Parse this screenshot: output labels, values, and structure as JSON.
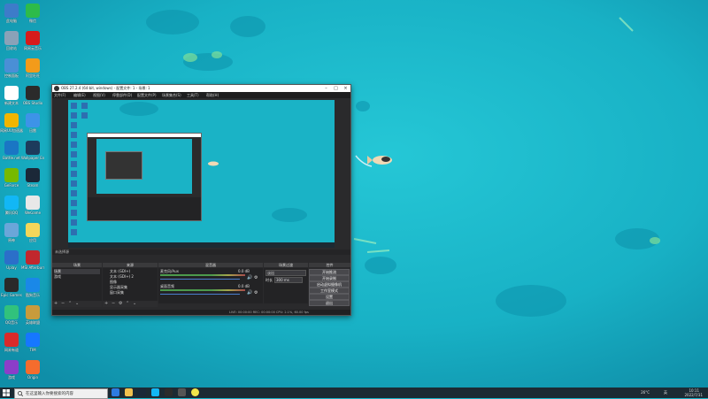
{
  "desktop": {
    "icons": [
      {
        "label": "此电脑",
        "color": "#3d7cc9"
      },
      {
        "label": "微信",
        "color": "#2dbb4a"
      },
      {
        "label": "回收站",
        "color": "#8aa2b8"
      },
      {
        "label": "网易云音乐",
        "color": "#d71b1b"
      },
      {
        "label": "控制面板",
        "color": "#4a8fd6"
      },
      {
        "label": "阿里旺旺",
        "color": "#f39b1a"
      },
      {
        "label": "新建文本",
        "color": "#ffffff"
      },
      {
        "label": "OBS Studio",
        "color": "#2b2b2b"
      },
      {
        "label": "网易UU加速器",
        "color": "#f0b500"
      },
      {
        "label": "迅雷",
        "color": "#3d93e8"
      },
      {
        "label": "Battle.net",
        "color": "#1a76c4"
      },
      {
        "label": "Wallpaper Engine",
        "color": "#1d3b5c"
      },
      {
        "label": "GeForce",
        "color": "#76b900"
      },
      {
        "label": "Steam",
        "color": "#1b2838"
      },
      {
        "label": "腾讯QQ",
        "color": "#12b7f5"
      },
      {
        "label": "WeGame",
        "color": "#e8e8e8"
      },
      {
        "label": "原神",
        "color": "#6aa6d9"
      },
      {
        "label": "应用",
        "color": "#f3d65a"
      },
      {
        "label": "Uplay",
        "color": "#2b6fc9"
      },
      {
        "label": "MSI Afterburner",
        "color": "#c1272d"
      },
      {
        "label": "Epic Games",
        "color": "#2a2a2a"
      },
      {
        "label": "酷狗音乐",
        "color": "#1a88e8"
      },
      {
        "label": "QQ音乐",
        "color": "#31c27c"
      },
      {
        "label": "英雄联盟",
        "color": "#c89b3c"
      },
      {
        "label": "网易有道",
        "color": "#d92a2a"
      },
      {
        "label": "TIM",
        "color": "#1677ff"
      },
      {
        "label": "游戏",
        "color": "#8b3ec9"
      },
      {
        "label": "Origin",
        "color": "#f56c2d"
      }
    ]
  },
  "obs": {
    "title": "OBS 27.2.4 (64-bit, windows) - 配置文件: 1 - 场景: 1",
    "menu": [
      "文件(F)",
      "编辑(E)",
      "视图(V)",
      "停靠部件(D)",
      "配置文件(P)",
      "场景集合(S)",
      "工具(T)",
      "帮助(H)"
    ],
    "preview_label": "未选择源",
    "docks": {
      "scenes": {
        "header": "场景",
        "items": [
          "场景",
          "游戏"
        ]
      },
      "sources": {
        "header": "来源",
        "items": [
          "文本 (GDI+)",
          "文本 (GDI+) 2",
          "图像",
          "显示器采集",
          "窗口采集"
        ]
      },
      "mixer": {
        "header": "混音器",
        "channels": [
          {
            "name": "麦克风/Aux",
            "level": "0.0 dB"
          },
          {
            "name": "桌面音频",
            "level": "0.0 dB"
          }
        ]
      },
      "transitions": {
        "header": "场景过渡",
        "type": "淡出",
        "duration_label": "时长",
        "duration": "300 ms"
      },
      "controls": {
        "header": "控件",
        "buttons": [
          "开始推流",
          "开始录制",
          "启动虚拟摄像机",
          "工作室模式",
          "设置",
          "退出"
        ]
      }
    },
    "status": "LIVE: 00:00:00   REC: 00:00:00   CPU: 2.1%, 60.00 fps"
  },
  "taskbar": {
    "search_placeholder": "在这里输入你要搜索的内容",
    "tray": {
      "temperature": "26°C",
      "network": "英",
      "time": "10:11",
      "date": "2022/7/31"
    }
  }
}
